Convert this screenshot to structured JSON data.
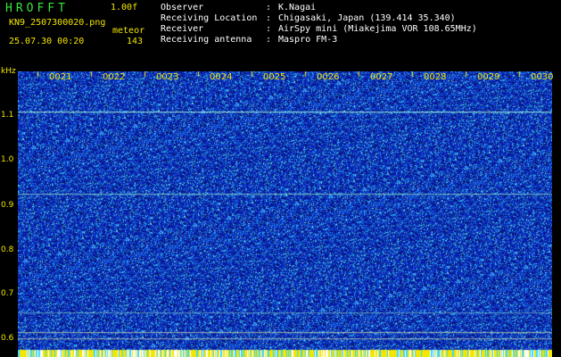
{
  "header": {
    "logo": "HROFFT",
    "version": "1.00f",
    "filename": "KN9_2507300020.png",
    "meteor_label": "meteor",
    "datetime": "25.07.30 00:20",
    "meteor_count": "143"
  },
  "info": [
    {
      "label": "Observer",
      "value": "K.Nagai"
    },
    {
      "label": "Receiving Location",
      "value": "Chigasaki, Japan (139.414 35.340)"
    },
    {
      "label": "Receiver",
      "value": "AirSpy mini (Miakejima VOR 108.65MHz)"
    },
    {
      "label": "Receiving antenna",
      "value": "Maspro FM-3"
    }
  ],
  "info_separator": ":",
  "axis": {
    "unit": "kHz",
    "freq_ticks": [
      "1.1",
      "1.0",
      "0.9",
      "0.8",
      "0.7",
      "0.6"
    ],
    "time_ticks": [
      "0021",
      "0022",
      "0023",
      "0024",
      "0025",
      "0026",
      "0027",
      "0028",
      "0029",
      "0030"
    ]
  },
  "colors": {
    "background": "#0a1e9a",
    "noise_bright": "#3fa8ff",
    "signal_line": "#8fe6d0",
    "label_yellow": "#f3e600",
    "logo_green": "#39e639"
  }
}
